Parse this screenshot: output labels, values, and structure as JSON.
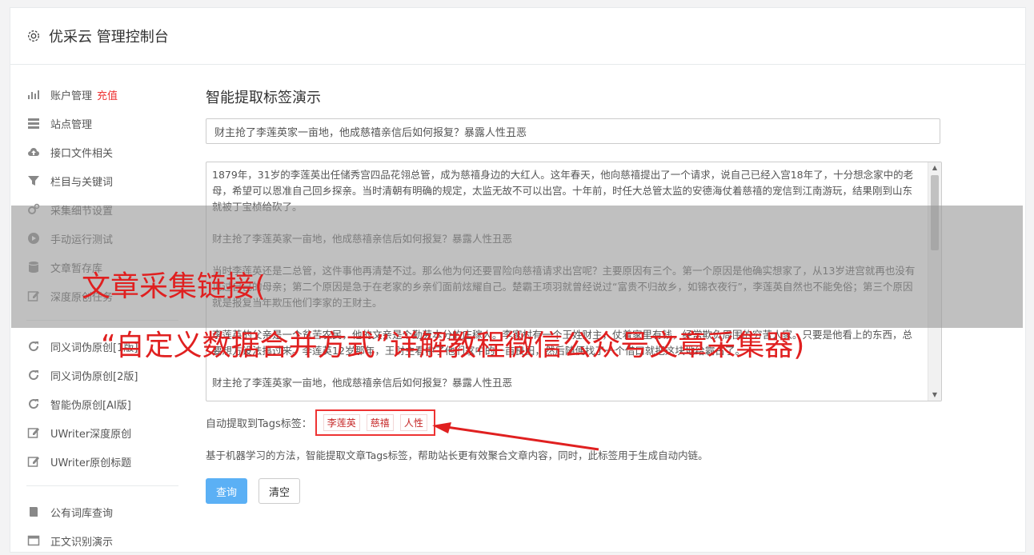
{
  "header": {
    "title": "优采云 管理控制台",
    "icon": "gear-icon"
  },
  "sidebar": {
    "group1": [
      {
        "label": "账户管理",
        "icon": "bar-chart-icon",
        "badge": "充值"
      },
      {
        "label": "站点管理",
        "icon": "server-icon"
      },
      {
        "label": "接口文件相关",
        "icon": "cloud-upload-icon"
      },
      {
        "label": "栏目与关键词",
        "icon": "filter-icon"
      },
      {
        "label": "采集细节设置",
        "icon": "cogs-icon"
      },
      {
        "label": "手动运行测试",
        "icon": "play-icon"
      },
      {
        "label": "文章暂存库",
        "icon": "database-icon"
      },
      {
        "label": "深度原创任务",
        "icon": "edit-icon"
      }
    ],
    "group2": [
      {
        "label": "同义词伪原创[1版]",
        "icon": "refresh-icon"
      },
      {
        "label": "同义词伪原创[2版]",
        "icon": "refresh-icon"
      },
      {
        "label": "智能伪原创[AI版]",
        "icon": "refresh-icon"
      },
      {
        "label": "UWriter深度原创",
        "icon": "edit-icon"
      },
      {
        "label": "UWriter原创标题",
        "icon": "edit-icon"
      }
    ],
    "group3": [
      {
        "label": "公有词库查询",
        "icon": "book-icon"
      },
      {
        "label": "正文识别演示",
        "icon": "window-icon"
      }
    ]
  },
  "main": {
    "heading": "智能提取标签演示",
    "title_value": "财主抢了李莲英家一亩地，他成慈禧亲信后如何报复？暴露人性丑恶",
    "article_paragraphs": [
      "1879年，31岁的李莲英出任储秀宫四品花翎总管，成为慈禧身边的大红人。这年春天，他向慈禧提出了一个请求，说自己已经入宫18年了，十分想念家中的老母，希望可以恩准自己回乡探亲。当时清朝有明确的规定，太监无故不可以出宫。十年前，时任大总管太监的安德海仗着慈禧的宠信到江南游玩，结果刚到山东就被丁宝桢给砍了。",
      "财主抢了李莲英家一亩地，他成慈禧亲信后如何报复？暴露人性丑恶",
      "当时李莲英还是二总管，这件事他再清楚不过。那么他为何还要冒险向慈禧请求出宫呢？主要原因有三个。第一个原因是他确实想家了，从13岁进宫就再也没有见过自己的母亲；第二个原因是急于在老家的乡亲们面前炫耀自己。楚霸王项羽就曾经说过“富贵不归故乡，如锦衣夜行”，李莲英自然也不能免俗；第三个原因就是报复当年欺压他们李家的王财主。",
      "李莲英的父亲是一个贫苦农民，他的文亲是个勤劳本分的庄稼人。李家村有一个王姓财主，仗着家里有钱，经常欺负周围的穷苦人家。只要是他看上的东西，总要想方设法搞过来。李莲英12岁那年，王财主看中了他们家中的一亩良田，然后随便找了一个借口就把这块地给霸占了。",
      "财主抢了李莲英家一亩地，他成慈禧亲信后如何报复？暴露人性丑恶"
    ],
    "tags_label": "自动提取到Tags标签：",
    "tags": [
      "李莲英",
      "慈禧",
      "人性"
    ],
    "description": "基于机器学习的方法，智能提取文章Tags标签，帮助站长更有效聚合文章内容，同时，此标签用于生成自动内链。",
    "query_button": "查询",
    "clear_button": "清空"
  },
  "overlay": {
    "line1": "文章采集链接(",
    "line2": "“自定义数据合并方式”详解教程微信公众号文章采集器)",
    "color": "#e02020"
  }
}
